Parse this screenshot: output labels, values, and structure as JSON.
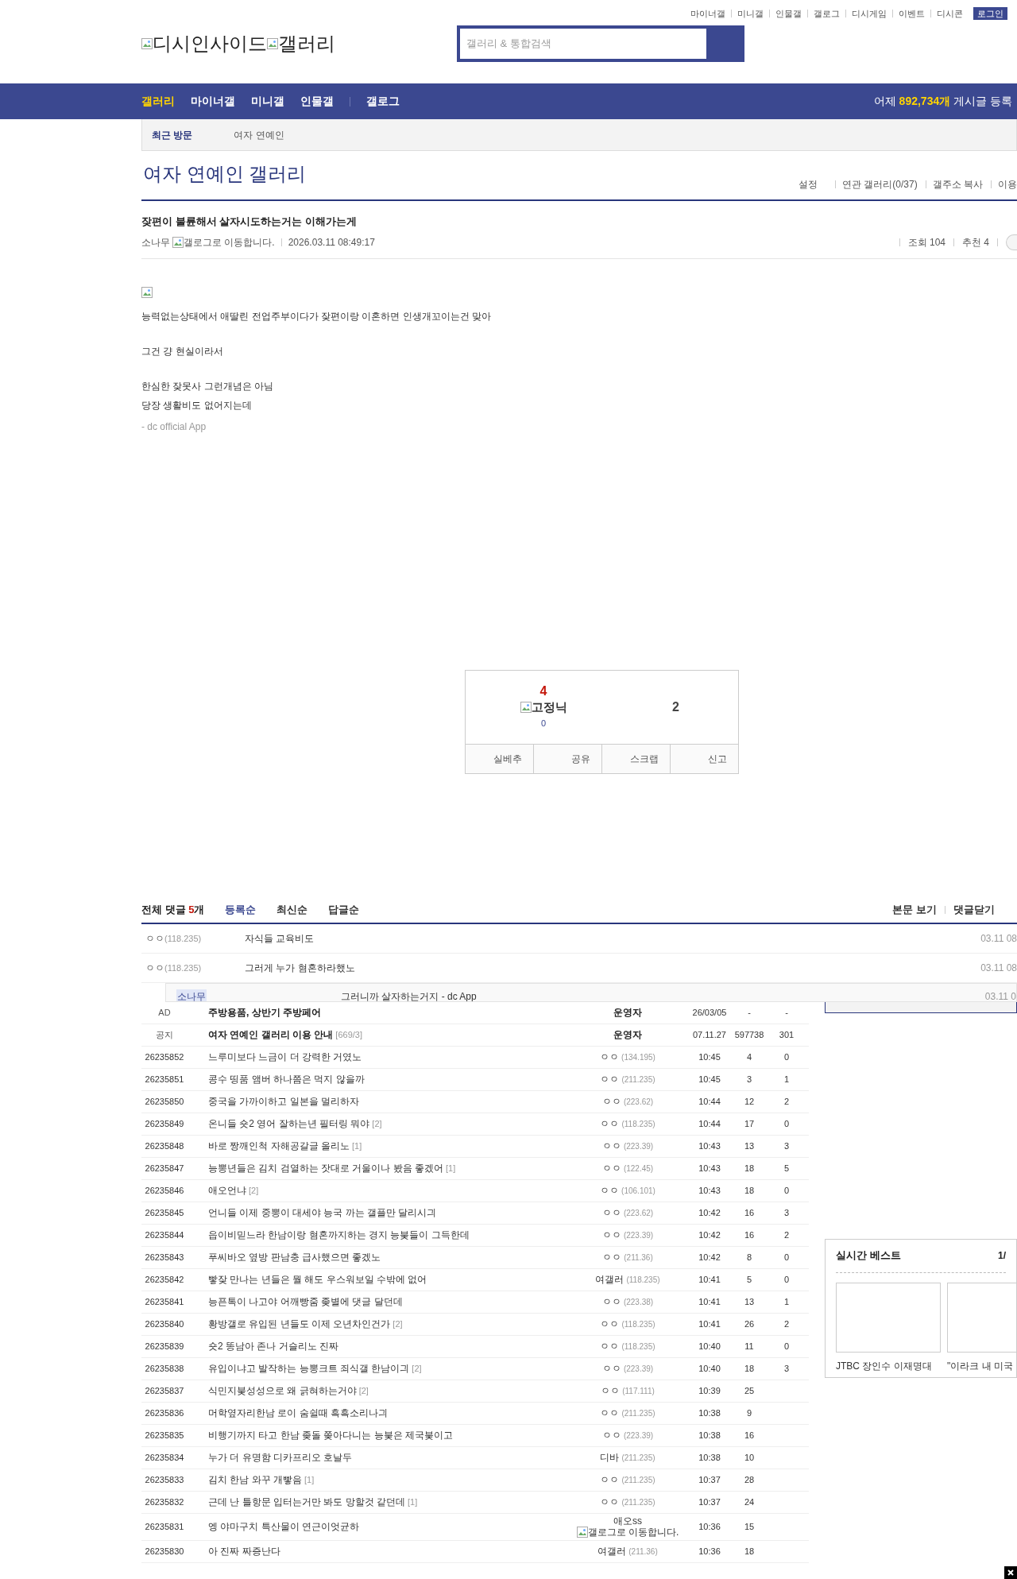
{
  "top_links": [
    "마이너갤",
    "미니갤",
    "인물갤",
    "갤로그",
    "디시게임",
    "이벤트",
    "디시콘"
  ],
  "login_button": "로그인",
  "logo": {
    "site": "디시인사이드",
    "section": "갤러리"
  },
  "search": {
    "placeholder": "갤러리 & 통합검색"
  },
  "nav": {
    "items": [
      {
        "label": "갤러리",
        "selected": true
      },
      {
        "label": "마이너갤",
        "selected": false
      },
      {
        "label": "미니갤",
        "selected": false
      },
      {
        "label": "인물갤",
        "selected": false
      },
      {
        "label": "갤로그",
        "selected": false
      }
    ],
    "stats": {
      "prefix": "어제",
      "count": "892,734개",
      "suffix": "게시글 등록"
    }
  },
  "recent": {
    "label": "최근 방문",
    "items": [
      "여자 연예인"
    ]
  },
  "gallery": {
    "title": "여자 연예인 갤러리",
    "tools": [
      "설정",
      "연관 갤러리(0/37)",
      "갤주소 복사",
      "이용"
    ]
  },
  "post": {
    "title": "잦편이 불륜해서 살자시도하는거는 이해가는게",
    "author": "소나무",
    "gallog": "갤로그로 이동합니다.",
    "date": "2026.03.11 08:49:17",
    "views": "조회 104",
    "recommend": "추천 4",
    "paragraphs": [
      [
        "능력없는상태에서 애딸린 전업주부이다가 잦편이랑 이혼하면 인생개꼬이는건 맞아"
      ],
      [
        "그건 걍 현실이라서"
      ],
      [
        "한심한 잦못사 그런개념은 아님",
        "당장 생활비도 없어지는데"
      ]
    ],
    "footer": "- dc official App"
  },
  "vote": {
    "up": "4",
    "fixed_nick": "고정닉",
    "fixed_count": "0",
    "down": "2",
    "buttons": [
      "실베추",
      "공유",
      "스크랩",
      "신고"
    ]
  },
  "comments": {
    "label": "전체 댓글",
    "count": "5",
    "unit": "개",
    "sorts": [
      {
        "label": "등록순",
        "selected": true
      },
      {
        "label": "최신순",
        "selected": false
      },
      {
        "label": "답글순",
        "selected": false
      }
    ],
    "actions": [
      "본문 보기",
      "댓글닫기"
    ],
    "items": [
      {
        "kind": "comment",
        "nick": "ㅇㅇ",
        "ip": "(118.235)",
        "text": "자식들 교육비도",
        "date": "03.11 08"
      },
      {
        "kind": "comment",
        "nick": "ㅇㅇ",
        "ip": "(118.235)",
        "text": "그러게 누가 혐혼하라했노",
        "date": "03.11 08"
      },
      {
        "kind": "reply",
        "nick": "소나무",
        "text": "그러니까 살자하는거지 - dc App",
        "date": "03.11 0"
      }
    ]
  },
  "posts": [
    {
      "kind": "ad",
      "num": "AD",
      "title": "주방용품, 상반기 주방페어",
      "writer": "운영자",
      "date": "26/03/05",
      "views": "-",
      "recommend": "-"
    },
    {
      "kind": "notice",
      "num": "공지",
      "title": "여자 연예인 갤러리 이용 안내",
      "replies": "[669/3]",
      "writer": "운영자",
      "date": "07.11.27",
      "views": "597738",
      "recommend": "301"
    },
    {
      "kind": "post",
      "num": "26235852",
      "title": "느루미보다 느금이 더 강력한 거였노",
      "writer": "ㅇㅇ",
      "ip": "(134.195)",
      "date": "10:45",
      "views": "4",
      "recommend": "0"
    },
    {
      "kind": "post",
      "num": "26235851",
      "title": "콩수 띵품 앰버 하나쯤은 먹지 않을까",
      "writer": "ㅇㅇ",
      "ip": "(211.235)",
      "date": "10:45",
      "views": "3",
      "recommend": "1"
    },
    {
      "kind": "post",
      "num": "26235850",
      "title": "중국을 가까이하고 일본을 멀리하자",
      "writer": "ㅇㅇ",
      "ip": "(223.62)",
      "date": "10:44",
      "views": "12",
      "recommend": "2"
    },
    {
      "kind": "post",
      "num": "26235849",
      "title": "온니들 숏2 영어 잘하는년 필터링 뭐야",
      "replies": "[2]",
      "writer": "ㅇㅇ",
      "ip": "(118.235)",
      "date": "10:44",
      "views": "17",
      "recommend": "0"
    },
    {
      "kind": "post",
      "num": "26235848",
      "title": "바로 짱깨인척 자해공갈글 올리노",
      "replies": "[1]",
      "writer": "ㅇㅇ",
      "ip": "(223.39)",
      "date": "10:43",
      "views": "13",
      "recommend": "3"
    },
    {
      "kind": "post",
      "num": "26235847",
      "title": "능뽕년들은 김치 검열하는 잣대로 거울이나 봤음 좋겠어",
      "replies": "[1]",
      "writer": "ㅇㅇ",
      "ip": "(122.45)",
      "date": "10:43",
      "views": "18",
      "recommend": "5"
    },
    {
      "kind": "post",
      "num": "26235846",
      "title": "애오언냐",
      "replies": "[2]",
      "writer": "ㅇㅇ",
      "ip": "(106.101)",
      "date": "10:43",
      "views": "18",
      "recommend": "0"
    },
    {
      "kind": "post",
      "num": "26235845",
      "title": "언니들 이제 중뽕이 대세야 능국 까는 갤플만 달리시긔",
      "writer": "ㅇㅇ",
      "ip": "(223.62)",
      "date": "10:42",
      "views": "16",
      "recommend": "3"
    },
    {
      "kind": "post",
      "num": "26235844",
      "title": "읍이비믿느라 한남이랑 혐혼까지하는 경지 능붖들이 그득한데",
      "writer": "ㅇㅇ",
      "ip": "(223.39)",
      "date": "10:42",
      "views": "16",
      "recommend": "2"
    },
    {
      "kind": "post",
      "num": "26235843",
      "title": "푸씨바오 옆방 판남충 급사했으면 좋겠노",
      "writer": "ㅇㅇ",
      "ip": "(211.36)",
      "date": "10:42",
      "views": "8",
      "recommend": "0"
    },
    {
      "kind": "post",
      "num": "26235842",
      "title": "빻잦 만나는 년들은 뭘 해도 우스워보일 수밖에 없어",
      "writer": "여갤러",
      "ip": "(118.235)",
      "date": "10:41",
      "views": "5",
      "recommend": "0"
    },
    {
      "kind": "post",
      "num": "26235841",
      "title": "능픈톡이 나고야 어깨빵줌 좆별에 댓글 달던데",
      "writer": "ㅇㅇ",
      "ip": "(223.38)",
      "date": "10:41",
      "views": "13",
      "recommend": "1"
    },
    {
      "kind": "post",
      "num": "26235840",
      "title": "황방갤로 유입된 년들도 이제 오년차인건가",
      "replies": "[2]",
      "writer": "ㅇㅇ",
      "ip": "(118.235)",
      "date": "10:41",
      "views": "26",
      "recommend": "2"
    },
    {
      "kind": "post",
      "num": "26235839",
      "title": "숏2 똥남아 존나 거슬리노 진짜",
      "writer": "ㅇㅇ",
      "ip": "(118.235)",
      "date": "10:40",
      "views": "11",
      "recommend": "0"
    },
    {
      "kind": "post",
      "num": "26235838",
      "title": "유입이냐고 발작하는 능뽕크트 죄식갤 한남이긔",
      "replies": "[2]",
      "writer": "ㅇㅇ",
      "ip": "(223.39)",
      "date": "10:40",
      "views": "18",
      "recommend": "3"
    },
    {
      "kind": "post",
      "num": "26235837",
      "title": "식민지붖성성으로 왜 긁혀하는거야",
      "replies": "[2]",
      "writer": "ㅇㅇ",
      "ip": "(117.111)",
      "date": "10:39",
      "views": "25"
    },
    {
      "kind": "post",
      "num": "26235836",
      "title": "머학옆자리한남 로이 숨쉴때 흑흑소리나긔",
      "writer": "ㅇㅇ",
      "ip": "(211.235)",
      "date": "10:38",
      "views": "9"
    },
    {
      "kind": "post",
      "num": "26235835",
      "title": "비행기까지 타고 한남 좆돌 쫒아다니는 능붖은 제국붖이고",
      "writer": "ㅇㅇ",
      "ip": "(223.39)",
      "date": "10:38",
      "views": "16"
    },
    {
      "kind": "post",
      "num": "26235834",
      "title": "누가 더 유명함 디카프리오 호날두",
      "writer": "디바",
      "ip": "(211.235)",
      "date": "10:38",
      "views": "10"
    },
    {
      "kind": "post",
      "num": "26235833",
      "title": "김치 한남 와꾸 개빻음",
      "replies": "[1]",
      "writer": "ㅇㅇ",
      "ip": "(211.235)",
      "date": "10:37",
      "views": "28"
    },
    {
      "kind": "post",
      "num": "26235832",
      "title": "근데 난 틀항문 입터는거만 봐도 망할것 같던데",
      "replies": "[1]",
      "writer": "ㅇㅇ",
      "ip": "(211.235)",
      "date": "10:37",
      "views": "24"
    },
    {
      "kind": "post",
      "num": "26235831",
      "title": "엥 야마구치 특산물이 연근이엇균하",
      "writer": "애오ss",
      "gallog": "갤로그로 이동합니다.",
      "date": "10:36",
      "views": "15"
    },
    {
      "kind": "post",
      "num": "26235830",
      "title": "아 진짜 짜증난다",
      "writer": "여갤러",
      "ip": "(211.36)",
      "date": "10:36",
      "views": "18"
    }
  ],
  "best": {
    "title": "실시간 베스트",
    "page": "1/",
    "items": [
      "JTBC 장인수 이재명대",
      "\"이라크 내 미국"
    ]
  }
}
